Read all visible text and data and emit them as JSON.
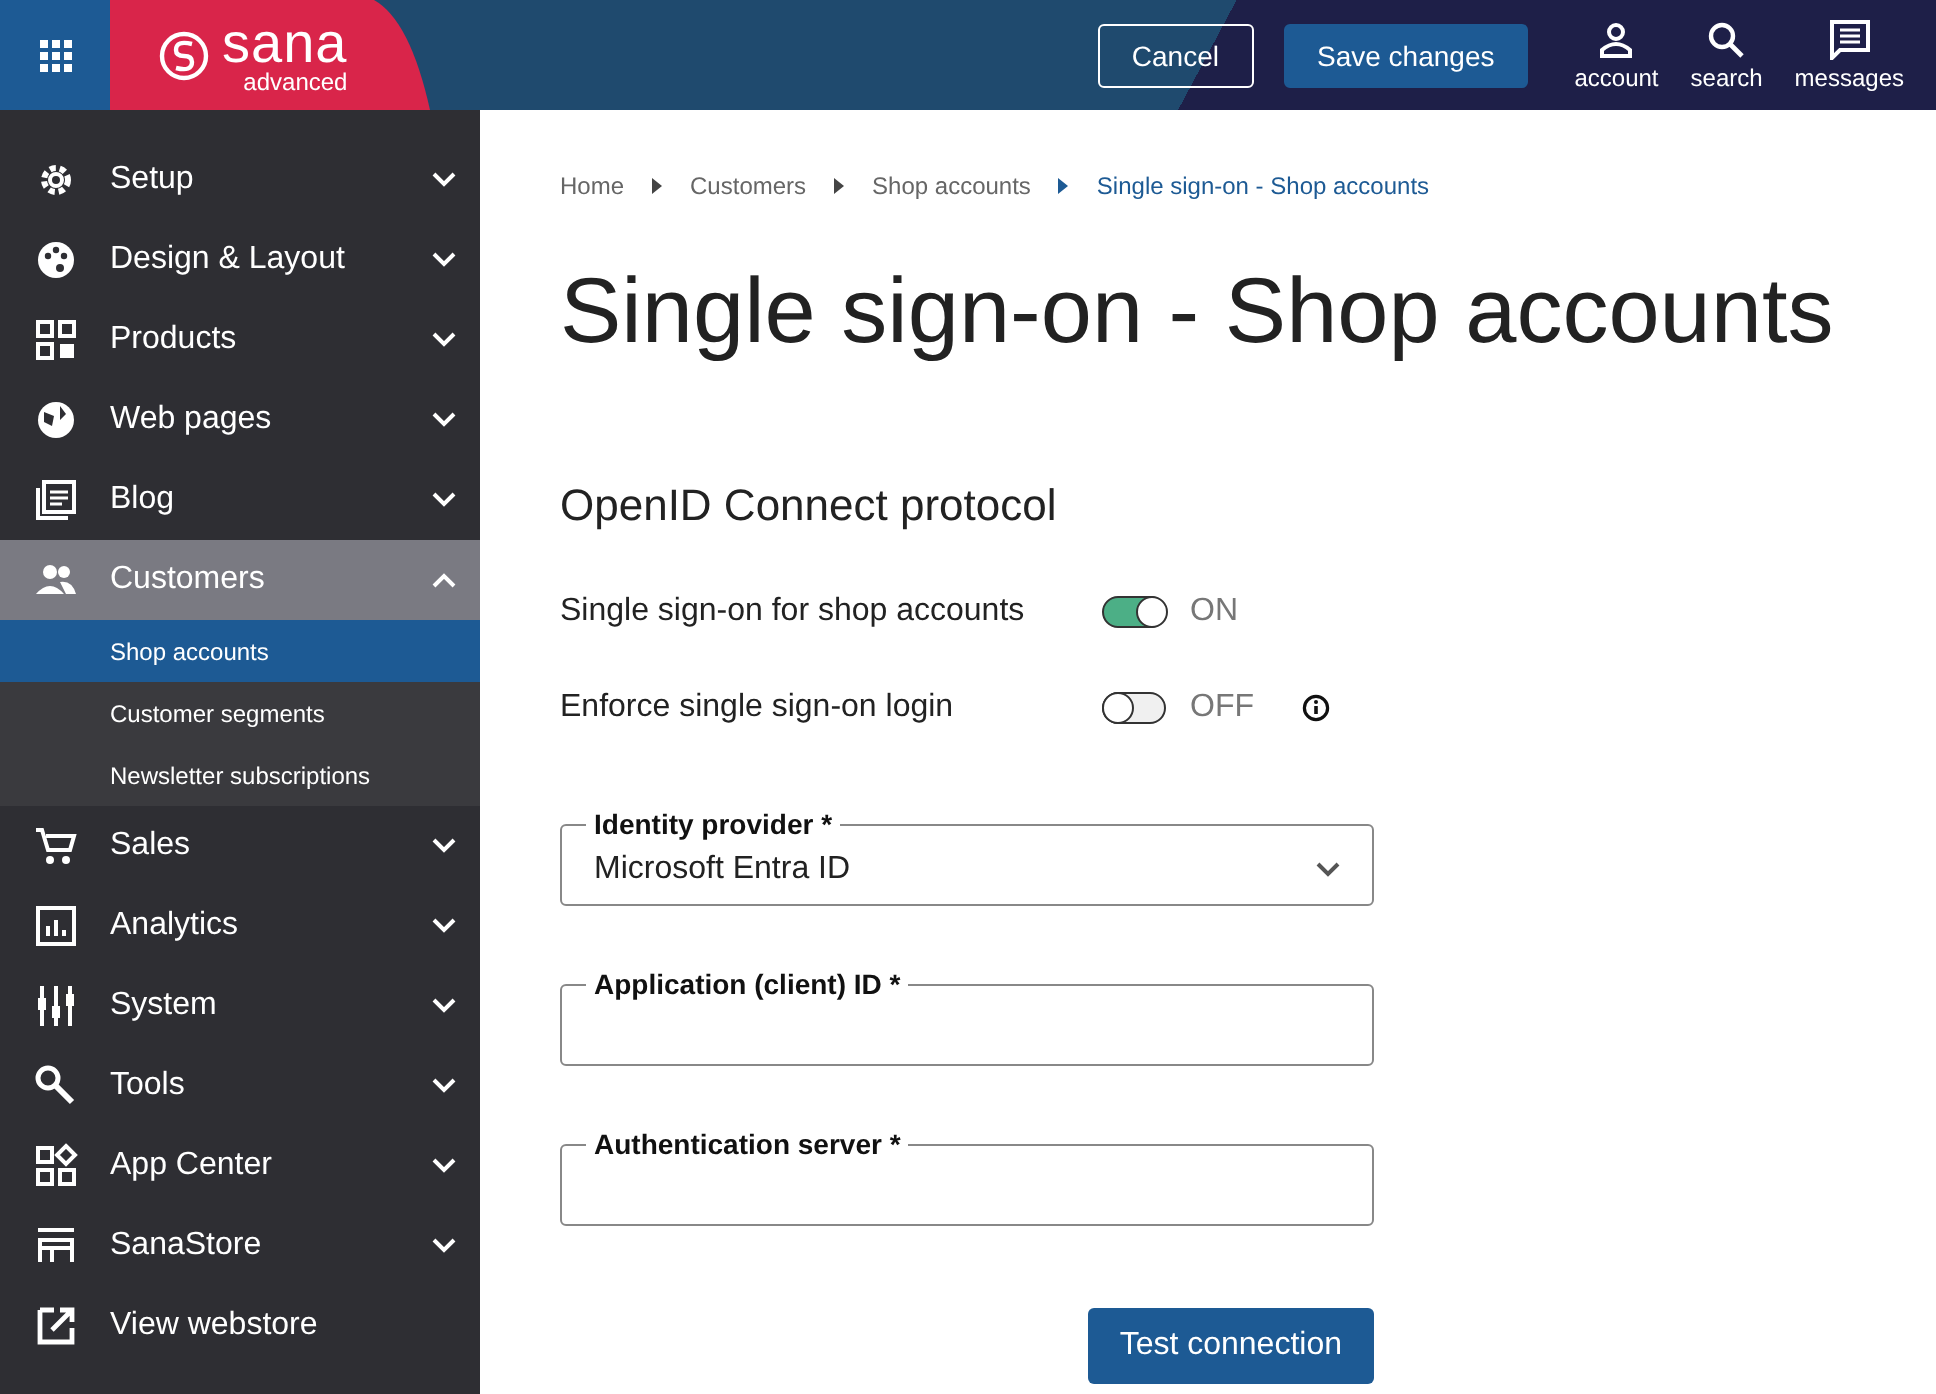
{
  "header": {
    "logo": {
      "name": "sana",
      "edition": "advanced"
    },
    "buttons": [
      {
        "label": "Cancel",
        "kind": "outline"
      },
      {
        "label": "Save changes",
        "kind": "primary"
      }
    ],
    "actions": [
      {
        "label": "account",
        "kind": "account"
      },
      {
        "label": "search",
        "kind": "search"
      },
      {
        "label": "messages",
        "kind": "messages"
      }
    ]
  },
  "sidebar": {
    "items": [
      {
        "label": "Setup",
        "kind": "group",
        "expanded": false,
        "selected": false
      },
      {
        "label": "Design & Layout",
        "kind": "group",
        "expanded": false,
        "selected": false
      },
      {
        "label": "Products",
        "kind": "group",
        "expanded": false,
        "selected": false
      },
      {
        "label": "Web pages",
        "kind": "group",
        "expanded": false,
        "selected": false
      },
      {
        "label": "Blog",
        "kind": "group",
        "expanded": false,
        "selected": false
      },
      {
        "label": "Customers",
        "kind": "group",
        "expanded": true,
        "selected": true,
        "children": [
          {
            "label": "Shop accounts",
            "selected": true
          },
          {
            "label": "Customer segments",
            "selected": false
          },
          {
            "label": "Newsletter subscriptions",
            "selected": false
          }
        ]
      },
      {
        "label": "Sales",
        "kind": "group",
        "expanded": false,
        "selected": false
      },
      {
        "label": "Analytics",
        "kind": "group",
        "expanded": false,
        "selected": false
      },
      {
        "label": "System",
        "kind": "group",
        "expanded": false,
        "selected": false
      },
      {
        "label": "Tools",
        "kind": "group",
        "expanded": false,
        "selected": false
      },
      {
        "label": "App Center",
        "kind": "group",
        "expanded": false,
        "selected": false
      },
      {
        "label": "SanaStore",
        "kind": "group",
        "expanded": false,
        "selected": false
      },
      {
        "label": "View webstore",
        "kind": "link",
        "selected": false
      }
    ]
  },
  "breadcrumb": [
    "Home",
    "Customers",
    "Shop accounts",
    "Single sign-on - Shop accounts"
  ],
  "title": "Single sign-on - Shop accounts",
  "section": "OpenID Connect protocol",
  "toggles": [
    {
      "label": "Single sign-on for shop accounts",
      "on": true,
      "state": "ON",
      "info": false
    },
    {
      "label": "Enforce single sign-on login",
      "on": false,
      "state": "OFF",
      "info": true
    }
  ],
  "fields": [
    {
      "label": "Identity provider *",
      "kind": "select",
      "value": "Microsoft Entra ID"
    },
    {
      "label": "Application (client) ID *",
      "kind": "text"
    },
    {
      "label": "Authentication server *",
      "kind": "text"
    }
  ],
  "action_button": "Test connection"
}
